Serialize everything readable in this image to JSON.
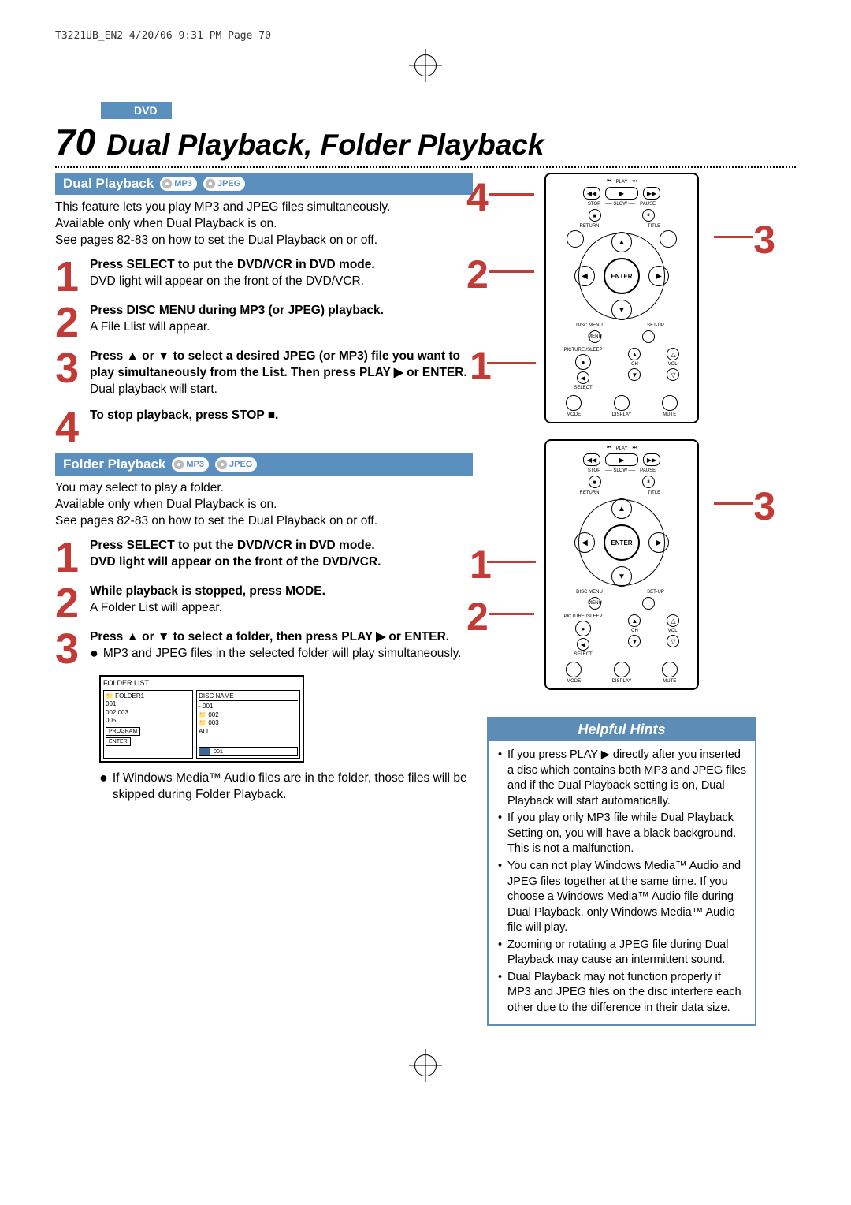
{
  "header_line": "T3221UB_EN2  4/20/06  9:31 PM  Page 70",
  "dvd_tab": "DVD",
  "page_number": "70",
  "page_title": "Dual Playback, Folder Playback",
  "badges": {
    "mp3": "MP3",
    "jpeg": "JPEG"
  },
  "dual": {
    "heading": "Dual Playback",
    "intro_l1": "This feature lets you play MP3 and JPEG files simultaneously.",
    "intro_l2": "Available only when Dual Playback is on.",
    "intro_l3": "See pages 82-83 on how to set the Dual Playback on or off.",
    "step1_b": "Press SELECT to put the DVD/VCR in DVD mode.",
    "step1_t": "DVD light will appear on the front of the DVD/VCR.",
    "step2_b": "Press DISC MENU during MP3 (or JPEG) playback.",
    "step2_t": "A File Llist will appear.",
    "step3_b": "Press ▲ or ▼ to select a desired JPEG (or MP3) file you want to play simultaneously from the List. Then press PLAY ▶ or ENTER.",
    "step3_t": "Dual playback will start.",
    "step4_b": "To stop playback, press STOP ■."
  },
  "folder": {
    "heading": "Folder Playback",
    "intro_l1": "You may select to play a folder.",
    "intro_l2": "Available only when Dual Playback is on.",
    "intro_l3": "See pages 82-83 on how to set the Dual Playback on or off.",
    "step1_b": "Press SELECT to put the DVD/VCR in DVD mode.",
    "step1_t": "DVD light will appear on the front of the DVD/VCR.",
    "step2_b": "While playback is stopped, press MODE.",
    "step2_t": "A Folder List will appear.",
    "step3_b": "Press ▲ or ▼ to select a folder, then press PLAY ▶ or ENTER.",
    "step3_bul1": "MP3 and JPEG files in the selected folder will play simultaneously.",
    "step3_bul2": "If Windows Media™ Audio files are in the folder, those files will be skipped during Folder Playback."
  },
  "folder_panel": {
    "title": "FOLDER LIST",
    "disc_label": "DISC NAME",
    "left_items": [
      "📁 FOLDER1",
      "  001",
      "  002   003",
      "  005"
    ],
    "right_items": [
      "- 001",
      "📁 002",
      "📁 003",
      "   ALL"
    ],
    "tabs": [
      "PROGRAM",
      "ENTER"
    ],
    "preview": "001"
  },
  "remote": {
    "play": "PLAY",
    "slow": "SLOW",
    "stop": "STOP",
    "pause": "PAUSE",
    "return": "RETURN",
    "title": "TITLE",
    "enter": "ENTER",
    "disc_menu": "DISC MENU",
    "setup": "SET-UP",
    "picture_sleep": "PICTURE /SLEEP",
    "ch": "CH",
    "vol": "VOL.",
    "select": "SELECT",
    "mode": "MODE",
    "display": "DISPLAY",
    "mute": "MUTE"
  },
  "hints": {
    "heading": "Helpful Hints",
    "items": [
      "If you press PLAY ▶ directly after you inserted a disc which contains both MP3 and JPEG files and if the Dual Playback setting is on, Dual Playback will start automatically.",
      "If you play only MP3 file while Dual Playback Setting on, you will have a black background. This is not a malfunction.",
      "You can not play Windows Media™ Audio and JPEG files together at the same time.  If you choose a Windows Media™ Audio file during Dual Playback, only Windows Media™ Audio file will play.",
      "Zooming or rotating a JPEG file during Dual Playback may cause an intermittent sound.",
      "Dual Playback may not function properly if MP3 and JPEG files on the disc interfere each other due to the difference in their data size."
    ]
  }
}
